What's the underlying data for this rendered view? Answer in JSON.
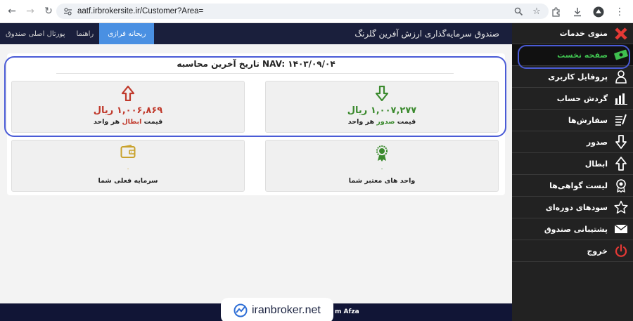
{
  "browser": {
    "url": "aatf.irbrokersite.ir/Customer?Area="
  },
  "topbar": {
    "brand": "صندوق سرمایه‌گذاری ارزش آفرین گلرنگ",
    "links": [
      "پورتال اصلی صندوق",
      "راهنما",
      "ریحانه فرازی"
    ]
  },
  "sidebar": {
    "items": [
      {
        "label": "منوی خدمات",
        "icon": "close-icon"
      },
      {
        "label": "صفحه نخست",
        "icon": "money-icon"
      },
      {
        "label": "پروفایل کاربری",
        "icon": "user-icon"
      },
      {
        "label": "گردش حساب",
        "icon": "bar-chart-icon"
      },
      {
        "label": "سفارش‌ها",
        "icon": "orders-icon"
      },
      {
        "label": "صدور",
        "icon": "arrow-down-icon"
      },
      {
        "label": "ابطال",
        "icon": "arrow-up-icon"
      },
      {
        "label": "لیست گواهی‌ها",
        "icon": "badge-icon"
      },
      {
        "label": "سودهای دوره‌ای",
        "icon": "star-icon"
      },
      {
        "label": "پشتیبانی صندوق",
        "icon": "mail-icon"
      },
      {
        "label": "خروج",
        "icon": "power-icon"
      }
    ]
  },
  "main": {
    "nav_title": "تاریخ آخرین محاسبه NAV: ۱۴۰۳/۰۹/۰۴",
    "issue_price": {
      "value": "۱,۰۰۷,۲۷۷ ریال",
      "caption_pre": "قیمت",
      "caption_hl": "صدور",
      "caption_post": "هر واحد"
    },
    "redeem_price": {
      "value": "۱,۰۰۶,۸۶۹ ریال",
      "caption_pre": "قیمت",
      "caption_hl": "ابطال",
      "caption_post": "هر واحد"
    },
    "valid_units": {
      "value": "۰",
      "caption": "واحد های معتبر شما"
    },
    "current_capital": {
      "value": "۰",
      "caption": "سرمایه فعلی شما"
    }
  },
  "footer": {
    "text": "m Afza"
  },
  "watermark": {
    "text": "iranbroker.net"
  },
  "colors": {
    "accent": "#4a90e2",
    "issue": "#3b8a2e",
    "redeem": "#c0392b",
    "sidebar_bg": "#222222",
    "topbar_bg": "#1a1f3c"
  }
}
